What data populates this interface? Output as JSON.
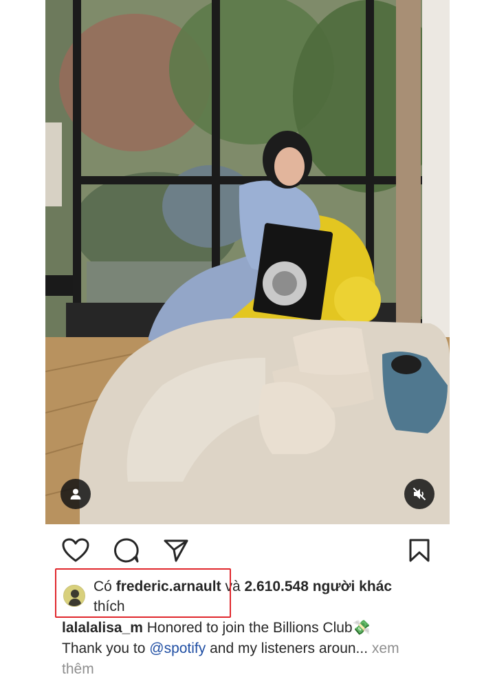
{
  "post": {
    "media": {
      "type": "video",
      "tag_icon": "person-icon",
      "mute_icon": "speaker-muted-icon"
    },
    "actions": {
      "like_icon": "heart-icon",
      "comment_icon": "comment-bubble-icon",
      "share_icon": "paper-plane-icon",
      "save_icon": "bookmark-icon"
    },
    "likes": {
      "prefix": "Có",
      "liked_by": "frederic.arnault",
      "connector": "và",
      "others_count": "2.610.548 người khác",
      "suffix": "thích"
    },
    "caption": {
      "username": "lalalalisa_m",
      "line1": "Honored to join the Billions Club",
      "emoji": "💸",
      "line2_prefix": "Thank you to",
      "mention": "@spotify",
      "line2_suffix": "and my listeners aroun...",
      "more_part1": "xem",
      "more_part2": "thêm"
    },
    "colors": {
      "highlight": "#e0262b",
      "mention": "#1f4ea3",
      "muted_text": "#8e8e8e",
      "chair_yellow": "#e9cf2c"
    }
  }
}
